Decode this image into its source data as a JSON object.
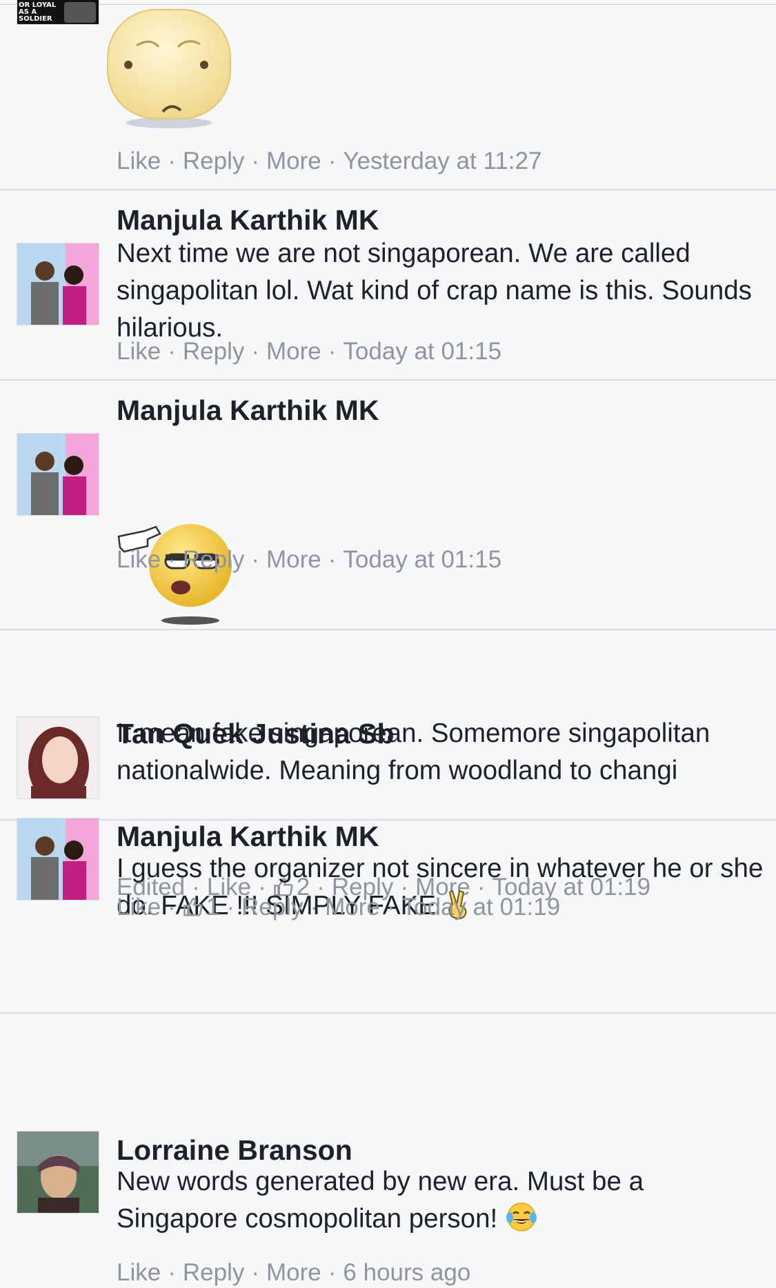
{
  "comments": [
    {
      "actions": {
        "like": "Like",
        "reply": "Reply",
        "more": "More",
        "time": "Yesterday at 11:27"
      },
      "avatar_text": "OR LOYAL AS A SOLDIER"
    },
    {
      "name": "Manjula Karthik MK",
      "text": "Next time we are not singaporean. We are called singapolitan lol. Wat kind of crap name is this. Sounds hilarious.",
      "actions": {
        "like": "Like",
        "reply": "Reply",
        "more": "More",
        "time": "Today at 01:15"
      }
    },
    {
      "name": "Manjula Karthik MK",
      "actions": {
        "like": "Like",
        "reply": "Reply",
        "more": "More",
        "time": "Today at 01:15"
      }
    },
    {
      "name": "Tan Quek Justina Sb",
      "text": "It mean fake singaporean. Somemore singapolitan nationalwide. Meaning from woodland to changi",
      "actions": {
        "edited": "Edited",
        "like": "Like",
        "like_count": "2",
        "reply": "Reply",
        "more": "More",
        "time": "Today at 01:19"
      }
    },
    {
      "name": "Manjula Karthik MK",
      "text": "I guess the organizer not sincere in whatever he or she do. FAKE !!! SIMPLY FAKE",
      "actions": {
        "like": "Like",
        "like_count": "1",
        "reply": "Reply",
        "more": "More",
        "time": "Today at 01:19"
      }
    },
    {
      "name": "Lorraine Branson",
      "text": "New words generated by new era. Must be a Singapore cosmopolitan person!",
      "actions": {
        "like": "Like",
        "reply": "Reply",
        "more": "More",
        "time": "6 hours ago"
      }
    }
  ],
  "colors": {
    "background": "#f6f7f9",
    "name_text": "#1d2129",
    "meta_text": "#90949c",
    "divider": "#dadde1"
  },
  "icons": [
    "worried-face-sticker",
    "pointing-squint-face-sticker",
    "thumbs-up-icon",
    "victory-hand-emoji",
    "tears-of-joy-emoji"
  ]
}
